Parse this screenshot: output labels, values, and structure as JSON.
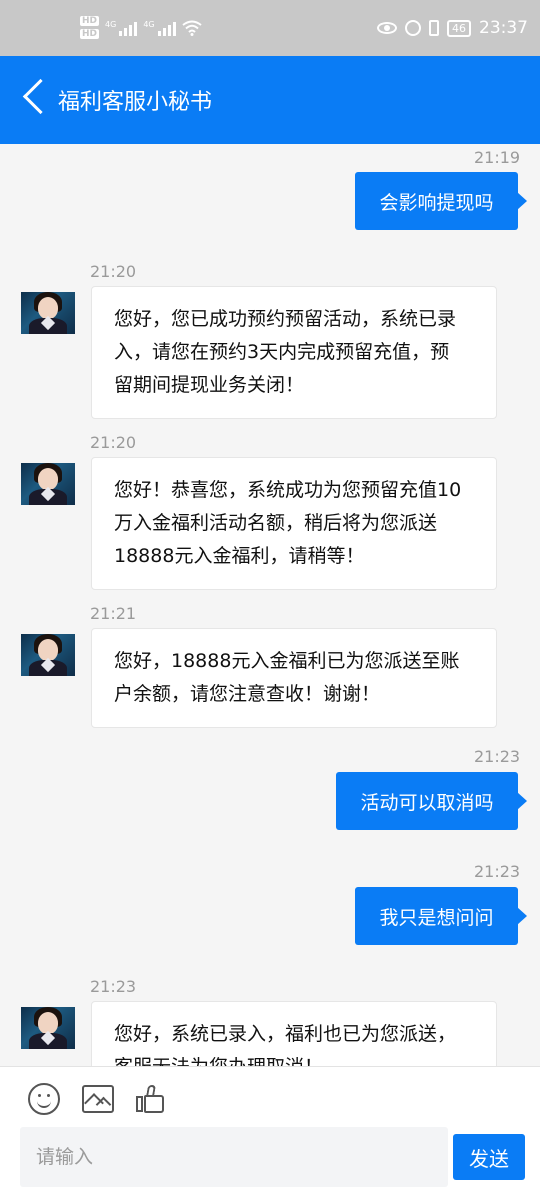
{
  "status_bar": {
    "hd1": "HD",
    "hd2": "HD",
    "net1": "4G",
    "net2": "4G",
    "battery": "46",
    "time": "23:37"
  },
  "header": {
    "title": "福利客服小秘书"
  },
  "messages": [
    {
      "time": "21:19",
      "dir": "out",
      "text": "会影响提现吗"
    },
    {
      "time": "21:20",
      "dir": "in",
      "lines": [
        "您好，您已成功预约预留活动，系统已录",
        "入，请您在预约3天内完成预留充值，预",
        "留期间提现业务关闭！"
      ]
    },
    {
      "time": "21:20",
      "dir": "in",
      "lines": [
        "您好！恭喜您，系统成功为您预留充值10",
        "万入金福利活动名额，稍后将为您派送",
        "18888元入金福利，请稍等！"
      ]
    },
    {
      "time": "21:21",
      "dir": "in",
      "lines": [
        "您好，18888元入金福利已为您派送至账",
        "户余额，请您注意查收！谢谢！"
      ]
    },
    {
      "time": "21:23",
      "dir": "out",
      "text": "活动可以取消吗"
    },
    {
      "time": "21:23",
      "dir": "out",
      "text": "我只是想问问"
    },
    {
      "time": "21:23",
      "dir": "in",
      "lines": [
        "您好，系统已录入，福利也已为您派送，",
        "客服无法为您办理取消！"
      ]
    }
  ],
  "composer": {
    "placeholder": "请输入",
    "send_label": "发送",
    "tools": [
      "emoji-icon",
      "image-icon",
      "thumbs-up-icon"
    ]
  },
  "colors": {
    "accent": "#0a7cf5",
    "status_bar": "#c8c8c8",
    "background": "#f5f5f5"
  }
}
